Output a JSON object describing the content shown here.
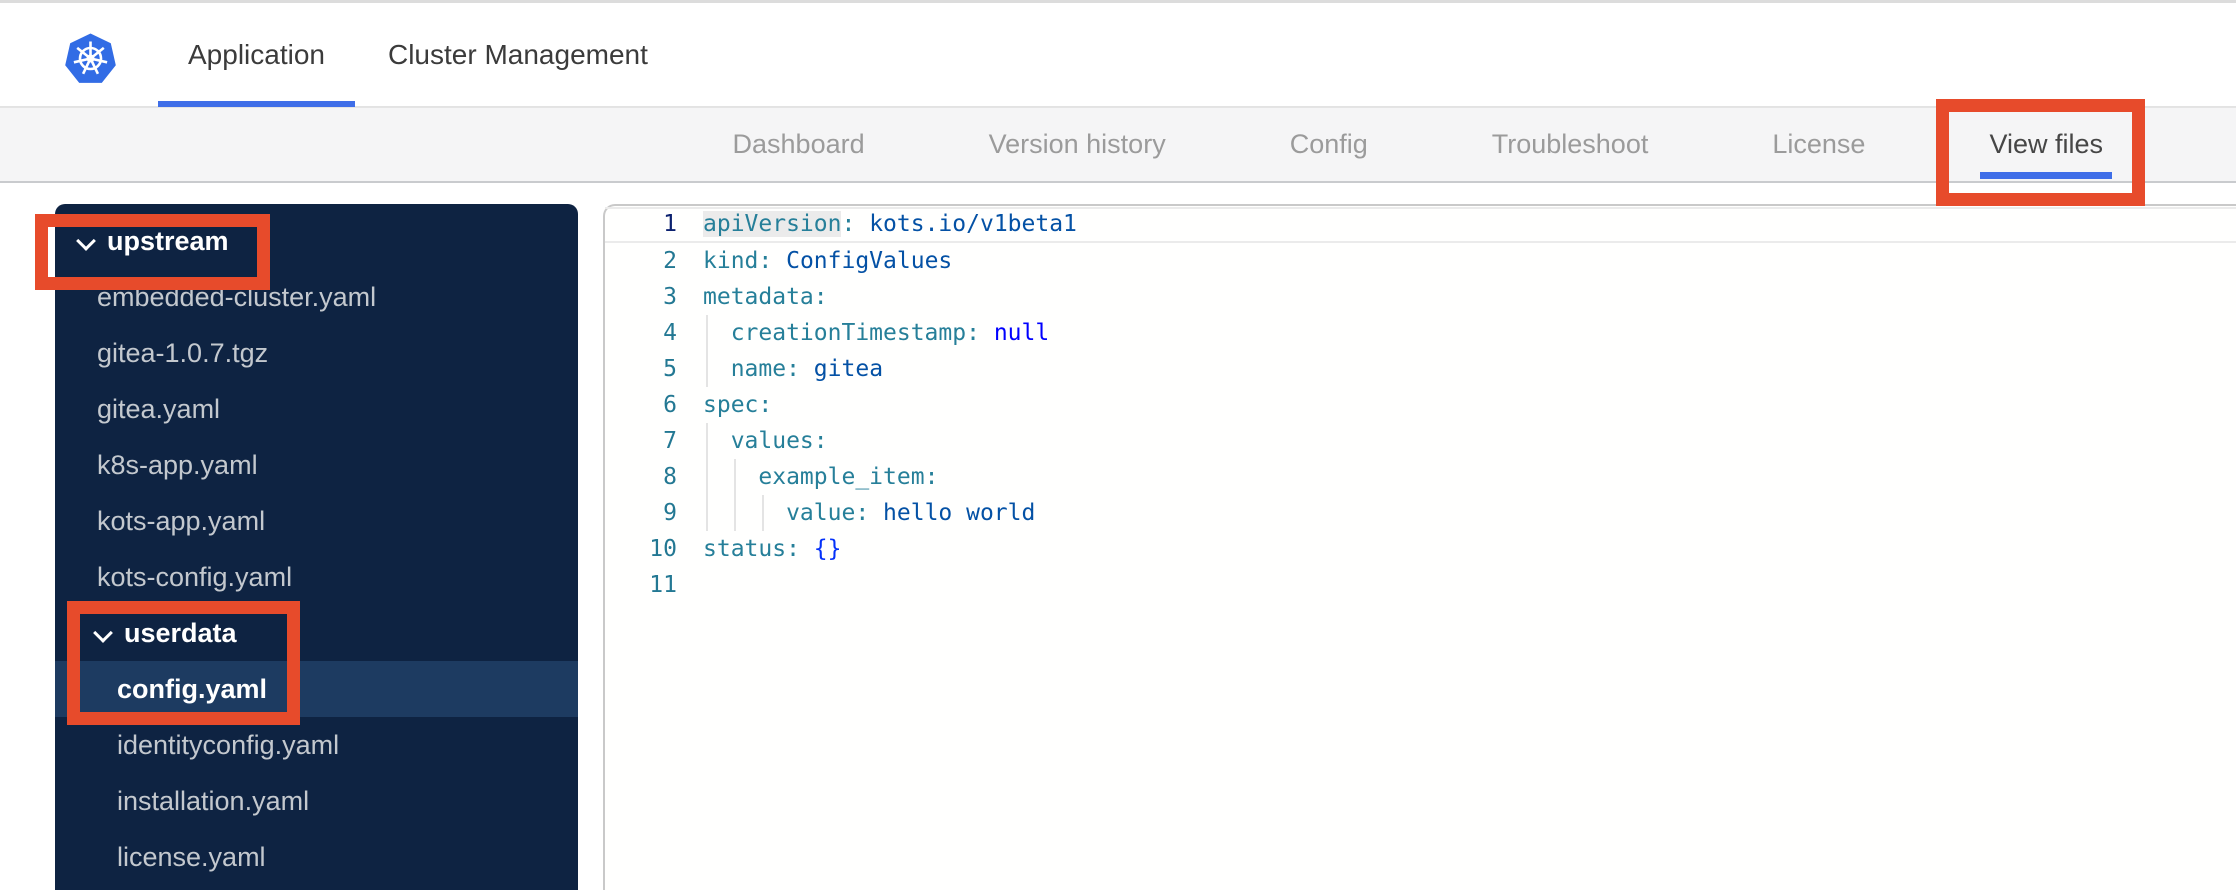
{
  "header": {
    "tabs": [
      {
        "id": "application",
        "label": "Application",
        "active": true
      },
      {
        "id": "cluster-management",
        "label": "Cluster Management",
        "active": false
      }
    ]
  },
  "nav": {
    "items": [
      {
        "id": "dashboard",
        "label": "Dashboard",
        "active": false
      },
      {
        "id": "version-history",
        "label": "Version history",
        "active": false
      },
      {
        "id": "config",
        "label": "Config",
        "active": false
      },
      {
        "id": "troubleshoot",
        "label": "Troubleshoot",
        "active": false
      },
      {
        "id": "license",
        "label": "License",
        "active": false
      },
      {
        "id": "view-files",
        "label": "View files",
        "active": true
      }
    ]
  },
  "file_tree": {
    "rows": [
      {
        "type": "folder",
        "label": "upstream",
        "level": 0,
        "expanded": true,
        "selected": false
      },
      {
        "type": "file",
        "label": "embedded-cluster.yaml",
        "level": 1,
        "selected": false
      },
      {
        "type": "file",
        "label": "gitea-1.0.7.tgz",
        "level": 1,
        "selected": false
      },
      {
        "type": "file",
        "label": "gitea.yaml",
        "level": 1,
        "selected": false
      },
      {
        "type": "file",
        "label": "k8s-app.yaml",
        "level": 1,
        "selected": false
      },
      {
        "type": "file",
        "label": "kots-app.yaml",
        "level": 1,
        "selected": false
      },
      {
        "type": "file",
        "label": "kots-config.yaml",
        "level": 1,
        "selected": false
      },
      {
        "type": "folder",
        "label": "userdata",
        "level": 1,
        "expanded": true,
        "selected": false
      },
      {
        "type": "file",
        "label": "config.yaml",
        "level": 2,
        "selected": true
      },
      {
        "type": "file",
        "label": "identityconfig.yaml",
        "level": 2,
        "selected": false
      },
      {
        "type": "file",
        "label": "installation.yaml",
        "level": 2,
        "selected": false
      },
      {
        "type": "file",
        "label": "license.yaml",
        "level": 2,
        "selected": false
      }
    ]
  },
  "editor": {
    "language": "yaml",
    "lines": [
      {
        "num": "1",
        "current": true,
        "guides": [],
        "tokens": [
          {
            "t": "key",
            "x": "apiVersion",
            "hl": true
          },
          {
            "t": "punc",
            "x": ":"
          },
          {
            "t": "val",
            "x": " kots.io/v1beta1"
          }
        ]
      },
      {
        "num": "2",
        "guides": [],
        "tokens": [
          {
            "t": "key",
            "x": "kind"
          },
          {
            "t": "punc",
            "x": ":"
          },
          {
            "t": "val",
            "x": " ConfigValues"
          }
        ]
      },
      {
        "num": "3",
        "guides": [],
        "tokens": [
          {
            "t": "key",
            "x": "metadata"
          },
          {
            "t": "punc",
            "x": ":"
          }
        ]
      },
      {
        "num": "4",
        "guides": [
          0
        ],
        "tokens": [
          {
            "t": "key",
            "x": "  creationTimestamp"
          },
          {
            "t": "punc",
            "x": ":"
          },
          {
            "t": "kw",
            "x": " null"
          }
        ]
      },
      {
        "num": "5",
        "guides": [
          0
        ],
        "tokens": [
          {
            "t": "key",
            "x": "  name"
          },
          {
            "t": "punc",
            "x": ":"
          },
          {
            "t": "val",
            "x": " gitea"
          }
        ]
      },
      {
        "num": "6",
        "guides": [],
        "tokens": [
          {
            "t": "key",
            "x": "spec"
          },
          {
            "t": "punc",
            "x": ":"
          }
        ]
      },
      {
        "num": "7",
        "guides": [
          0
        ],
        "tokens": [
          {
            "t": "key",
            "x": "  values"
          },
          {
            "t": "punc",
            "x": ":"
          }
        ]
      },
      {
        "num": "8",
        "guides": [
          0,
          1
        ],
        "tokens": [
          {
            "t": "key",
            "x": "    example_item"
          },
          {
            "t": "punc",
            "x": ":"
          }
        ]
      },
      {
        "num": "9",
        "guides": [
          0,
          1,
          2
        ],
        "tokens": [
          {
            "t": "key",
            "x": "      value"
          },
          {
            "t": "punc",
            "x": ":"
          },
          {
            "t": "val",
            "x": " hello world"
          }
        ]
      },
      {
        "num": "10",
        "guides": [],
        "tokens": [
          {
            "t": "key",
            "x": "status"
          },
          {
            "t": "punc",
            "x": ":"
          },
          {
            "t": "brace",
            "x": " {}"
          }
        ]
      },
      {
        "num": "11",
        "guides": [],
        "tokens": []
      }
    ]
  },
  "annotations": {
    "color": "#e74b2b",
    "highlight_boxes": [
      {
        "target": "view-files-tab"
      },
      {
        "target": "upstream-folder"
      },
      {
        "target": "userdata-config-yaml"
      }
    ]
  },
  "theme": {
    "accent_blue": "#3f6ee8",
    "logo_blue": "#326ce5",
    "sidebar_bg": "#0e2342",
    "sidebar_selected_bg": "#1d3b61",
    "code_key": "#267f99",
    "code_value": "#0451a5",
    "code_keyword": "#0000ff",
    "code_brace": "#0431fa",
    "line_number": "#237893",
    "line_number_active": "#0b216f"
  }
}
